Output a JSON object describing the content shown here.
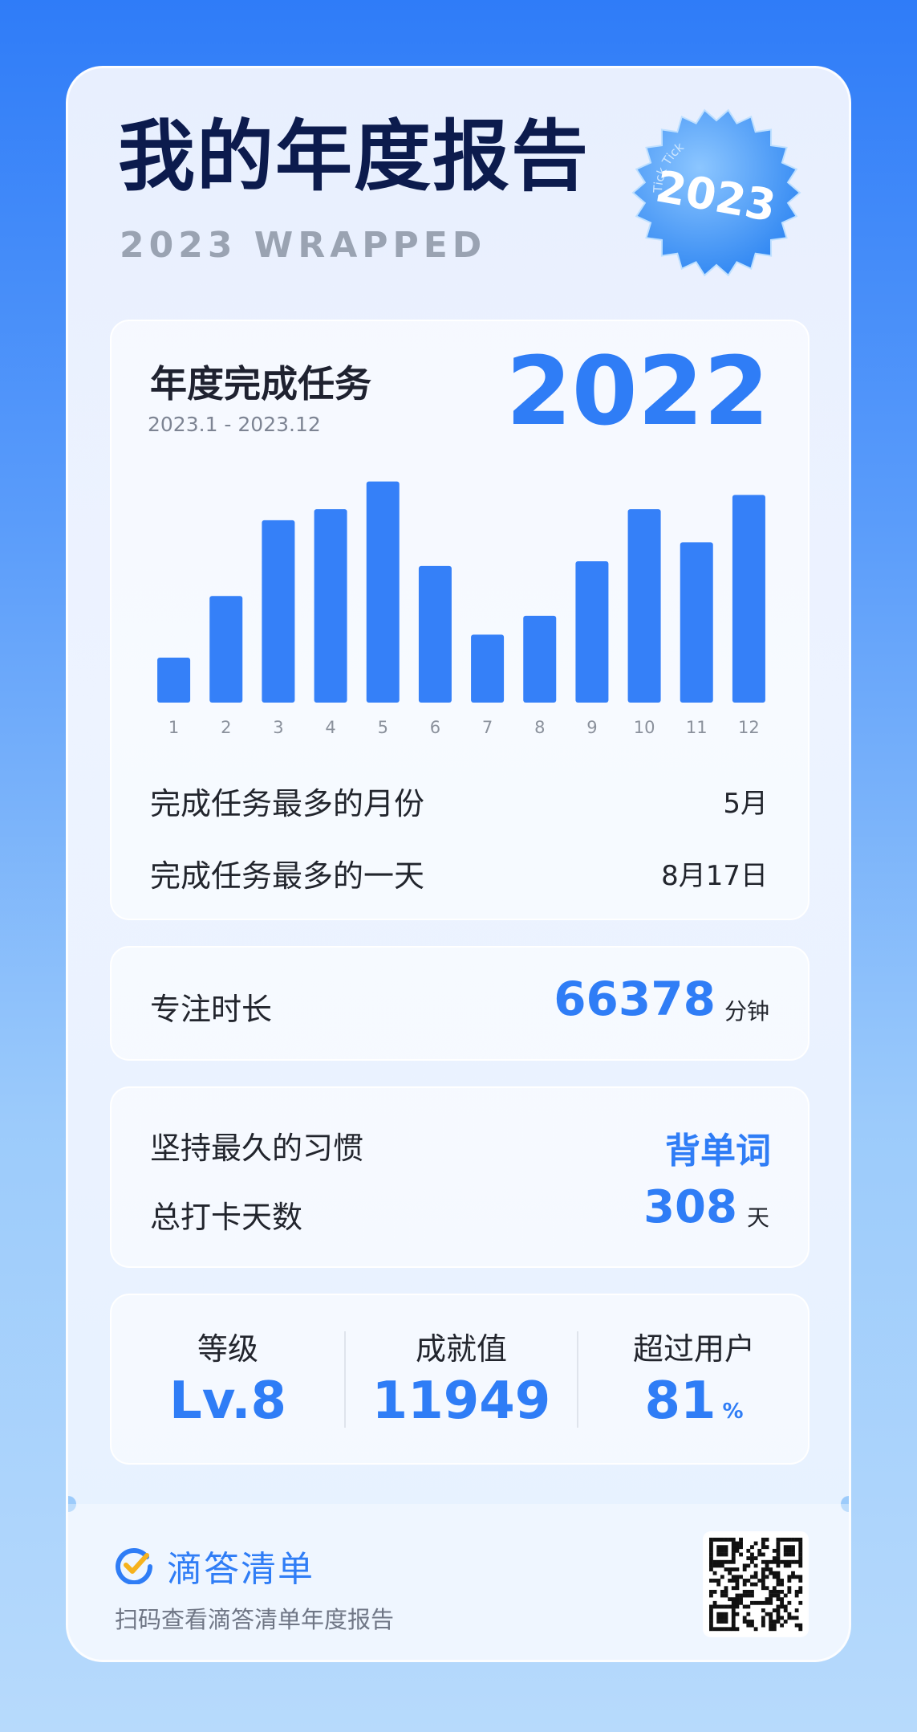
{
  "header": {
    "title": "我的年度报告",
    "subtitle": "2023 WRAPPED",
    "badge_year": "2023",
    "badge_ring_text": "Tick Tick"
  },
  "tasks": {
    "title": "年度完成任务",
    "date_range": "2023.1 - 2023.12",
    "total": "2022",
    "rows": [
      {
        "label": "完成任务最多的月份",
        "value": "5月"
      },
      {
        "label": "完成任务最多的一天",
        "value": "8月17日"
      }
    ]
  },
  "chart_data": {
    "type": "bar",
    "title": "年度完成任务",
    "categories": [
      "1",
      "2",
      "3",
      "4",
      "5",
      "6",
      "7",
      "8",
      "9",
      "10",
      "11",
      "12"
    ],
    "values": [
      57,
      135,
      231,
      245,
      280,
      173,
      86,
      110,
      179,
      245,
      203,
      263
    ],
    "ylim": [
      0,
      300
    ],
    "grid": false,
    "color": "#3580f8"
  },
  "focus": {
    "label": "专注时长",
    "value": "66378",
    "unit": "分钟"
  },
  "habit": {
    "label": "坚持最久的习惯",
    "value": "背单词",
    "days_label": "总打卡天数",
    "days_value": "308",
    "days_unit": "天"
  },
  "stats": {
    "level_label": "等级",
    "level_value": "Lv.8",
    "achievement_label": "成就值",
    "achievement_value": "11949",
    "beat_label": "超过用户",
    "beat_value": "81",
    "beat_unit": "%"
  },
  "footer": {
    "brand": "滴答清单",
    "scan_text": "扫码查看滴答清单年度报告"
  },
  "colors": {
    "accent": "#2f7df6",
    "title": "#0c1b4d"
  }
}
